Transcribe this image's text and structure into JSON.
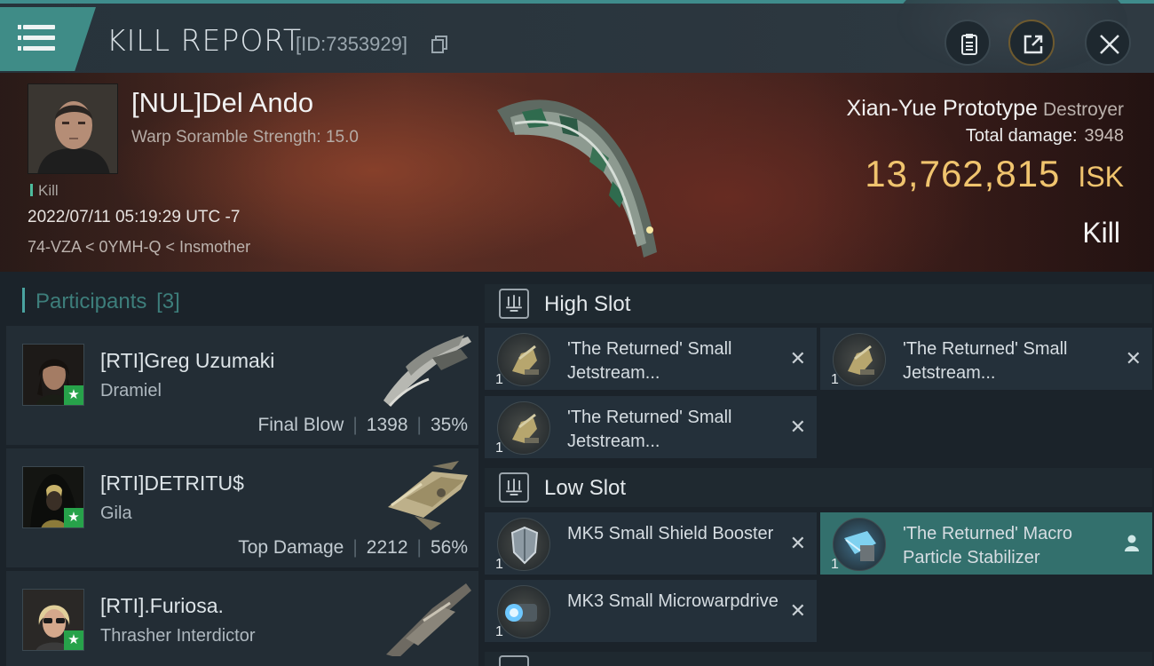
{
  "header": {
    "title": "KILL REPORT",
    "report_id": "[ID:7353929]",
    "icons": [
      "menu-icon",
      "copy-icon",
      "clipboard-icon",
      "share-icon",
      "close-icon"
    ]
  },
  "victim": {
    "name": "[NUL]Del Ando",
    "subtitle": "Warp Soramble Strength: 15.0",
    "tag": "Kill",
    "timestamp": "2022/07/11 05:19:29 UTC -7",
    "location": "74-VZA < 0YMH-Q < Insmother",
    "ship_name": "Xian-Yue Prototype",
    "ship_class": "Destroyer",
    "total_damage_label": "Total damage:",
    "total_damage": "3948",
    "isk_value": "13,762,815",
    "isk_unit": "ISK",
    "result": "Kill"
  },
  "participants": {
    "label": "Participants",
    "count": "[3]",
    "rows": [
      {
        "name": "[RTI]Greg Uzumaki",
        "ship": "Dramiel",
        "role": "Final Blow",
        "damage": "1398",
        "percent": "35%"
      },
      {
        "name": "[RTI]DETRITU$",
        "ship": "Gila",
        "role": "Top Damage",
        "damage": "2212",
        "percent": "56%"
      },
      {
        "name": "[RTI].Furiosa.",
        "ship": "Thrasher Interdictor"
      }
    ]
  },
  "slots": {
    "high": {
      "label": "High Slot",
      "items": [
        {
          "name": "'The Returned' Small Jetstream...",
          "qty": "1"
        },
        {
          "name": "'The Returned' Small Jetstream...",
          "qty": "1"
        },
        {
          "name": "'The Returned' Small Jetstream...",
          "qty": "1"
        }
      ]
    },
    "low": {
      "label": "Low Slot",
      "items": [
        {
          "name": "MK5 Small Shield Booster",
          "qty": "1"
        },
        {
          "name": "'The Returned' Macro Particle Stabilizer",
          "qty": "1"
        },
        {
          "name": "MK3 Small Microwarpdrive",
          "qty": "1"
        }
      ]
    },
    "destroyed_mark": "✕"
  },
  "colors": {
    "accent": "#3f8c87",
    "isk": "#f0c46e",
    "star": "#27a24a",
    "selected": "#33706d"
  }
}
